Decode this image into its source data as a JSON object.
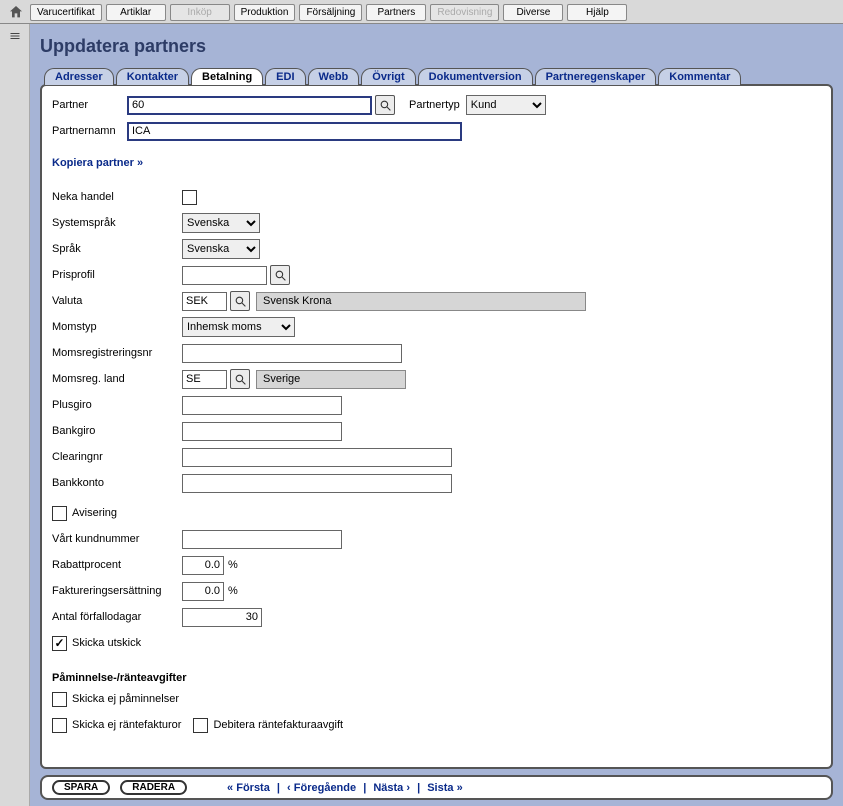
{
  "topnav": {
    "items": [
      {
        "label": "Varucertifikat",
        "disabled": false
      },
      {
        "label": "Artiklar",
        "disabled": false
      },
      {
        "label": "Inköp",
        "disabled": true
      },
      {
        "label": "Produktion",
        "disabled": false
      },
      {
        "label": "Försäljning",
        "disabled": false
      },
      {
        "label": "Partners",
        "disabled": false
      },
      {
        "label": "Redovisning",
        "disabled": true
      },
      {
        "label": "Diverse",
        "disabled": false
      },
      {
        "label": "Hjälp",
        "disabled": false
      }
    ]
  },
  "page": {
    "title": "Uppdatera partners"
  },
  "subtabs": [
    {
      "label": "Adresser"
    },
    {
      "label": "Kontakter"
    },
    {
      "label": "Betalning",
      "active": true
    },
    {
      "label": "EDI"
    },
    {
      "label": "Webb"
    },
    {
      "label": "Övrigt"
    },
    {
      "label": "Dokumentversion"
    },
    {
      "label": "Partneregenskaper"
    },
    {
      "label": "Kommentar"
    }
  ],
  "form": {
    "partner_label": "Partner",
    "partner_value": "60",
    "partnertyp_label": "Partnertyp",
    "partnertyp_value": "Kund",
    "partnernamn_label": "Partnernamn",
    "partnernamn_value": "ICA",
    "copy_link": "Kopiera partner »",
    "neka_label": "Neka handel",
    "syssprak_label": "Systemspråk",
    "syssprak_value": "Svenska",
    "sprak_label": "Språk",
    "sprak_value": "Svenska",
    "prisprofil_label": "Prisprofil",
    "prisprofil_value": "",
    "valuta_label": "Valuta",
    "valuta_value": "SEK",
    "valuta_name": "Svensk Krona",
    "momstyp_label": "Momstyp",
    "momstyp_value": "Inhemsk moms",
    "momsreg_label": "Momsregistreringsnr",
    "momsreg_value": "",
    "momsland_label": "Momsreg. land",
    "momsland_value": "SE",
    "momsland_name": "Sverige",
    "plusgiro_label": "Plusgiro",
    "plusgiro_value": "",
    "bankgiro_label": "Bankgiro",
    "bankgiro_value": "",
    "clearing_label": "Clearingnr",
    "clearing_value": "",
    "bankkonto_label": "Bankkonto",
    "bankkonto_value": "",
    "avisering_label": "Avisering",
    "kundnr_label": "Vårt kundnummer",
    "kundnr_value": "",
    "rabatt_label": "Rabattprocent",
    "rabatt_value": "0.0",
    "pct": "%",
    "fakt_label": "Faktureringsersättning",
    "fakt_value": "0.0",
    "forfallo_label": "Antal förfallodagar",
    "forfallo_value": "30",
    "utskick_label": "Skicka utskick"
  },
  "fees": {
    "title": "Påminnelse-/ränteavgifter",
    "skip_reminders": "Skicka ej påminnelser",
    "skip_interest": "Skicka ej räntefakturor",
    "debit_fee": "Debitera räntefakturaavgift"
  },
  "footer": {
    "save": "SPARA",
    "delete": "RADERA",
    "first": "« Första",
    "prev": "‹ Föregående",
    "next": "Nästa ›",
    "last": "Sista »"
  }
}
